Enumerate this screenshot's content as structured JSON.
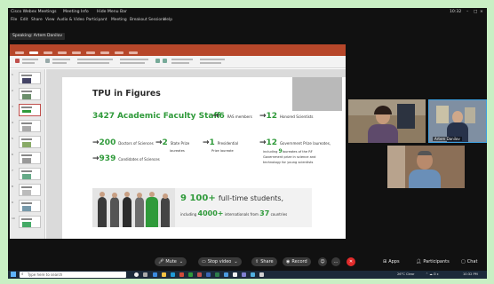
{
  "webex": {
    "app_title": "Cisco Webex Meetings",
    "meeting_info": "Meeting Info",
    "hide_menu_bar": "Hide Menu Bar",
    "clock": "10:32",
    "menu": [
      "File",
      "Edit",
      "Share",
      "View",
      "Audio & Video",
      "Participant",
      "Meeting",
      "Breakout Sessions",
      "Help"
    ],
    "speaking": "Speaking: Artem Danilov"
  },
  "slide": {
    "title": "TPU in Figures",
    "faculty_count": "3427",
    "faculty_label": "Academic Faculty Staff",
    "ras_count": "6",
    "ras_label": "RAS members",
    "honored_count": "12",
    "honored_label": "Honored Scientists",
    "doctors_count": "200",
    "doctors_label": "Doctors of Sciences",
    "state_prize_count": "2",
    "state_prize_label_1": "State Prize",
    "state_prize_label_2": "laureates",
    "presidential_count": "1",
    "presidential_label_1": "Presidential",
    "presidential_label_2": "Prize laureate",
    "gov_count": "12",
    "gov_label": "Government Prize laureates,",
    "gov_sub_1a": "including",
    "gov_sub_1b": "9",
    "gov_sub_1c": "laureates of the RF",
    "gov_sub_2": "Government prize in science and",
    "gov_sub_3": "technology for young scientists",
    "candidates_count": "939",
    "candidates_label": "Candidates of Sciences",
    "students_count": "9 100+",
    "students_label": "full-time students,",
    "intl_prefix": "including",
    "intl_count": "4000+",
    "intl_mid": "internationals from",
    "countries_count": "37",
    "countries_label": "countries"
  },
  "participants": {
    "tile2_name": "Artem Danilov"
  },
  "controls": {
    "mute": "Mute",
    "stop_video": "Stop video",
    "share": "Share",
    "record": "Record",
    "apps": "Apps",
    "participants": "Participants",
    "chat": "Chat"
  },
  "taskbar": {
    "search_placeholder": "Type here to search",
    "weather": "26°C Clear",
    "time": "10:32 PM"
  },
  "colors": {
    "accent_green": "#2f9a3a",
    "leave_red": "#e12b2b",
    "ppt_brand": "#b7472a"
  }
}
